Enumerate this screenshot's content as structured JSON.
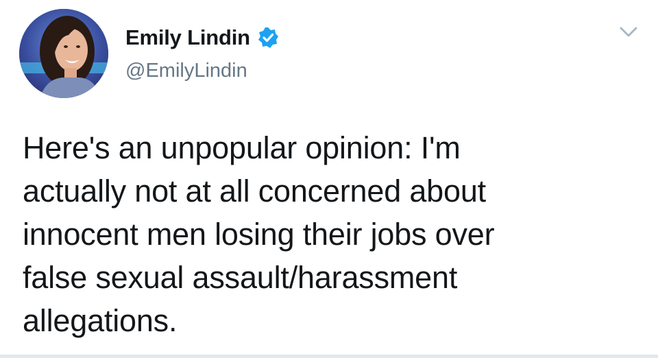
{
  "user": {
    "display_name": "Emily Lindin",
    "handle": "@EmilyLindin",
    "verified": true,
    "avatar_icon": "profile-photo"
  },
  "tweet": {
    "lines": [
      "Here's an unpopular opinion: I'm",
      "actually not at all concerned about",
      "innocent men losing their jobs over",
      "false sexual assault/harassment",
      "allegations."
    ]
  },
  "icons": {
    "verified": "verified-badge-icon",
    "menu": "chevron-down-icon"
  },
  "colors": {
    "verified_blue": "#1da1f2",
    "handle_gray": "#657786",
    "text": "#14171a",
    "chevron_gray": "#aab8c2"
  }
}
